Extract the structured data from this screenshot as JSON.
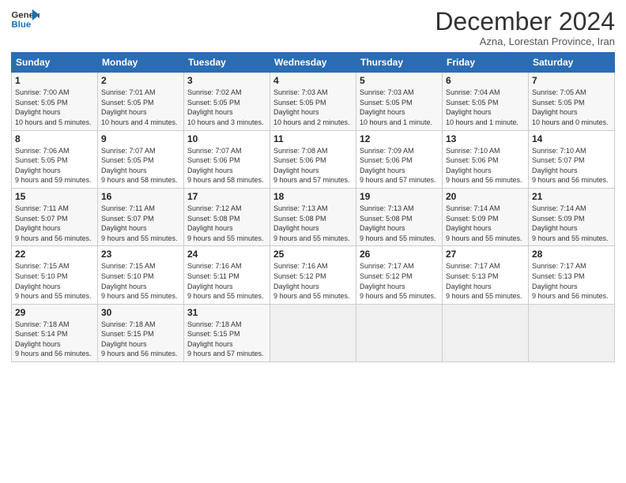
{
  "header": {
    "logo_line1": "General",
    "logo_line2": "Blue",
    "month_title": "December 2024",
    "location": "Azna, Lorestan Province, Iran"
  },
  "weekdays": [
    "Sunday",
    "Monday",
    "Tuesday",
    "Wednesday",
    "Thursday",
    "Friday",
    "Saturday"
  ],
  "weeks": [
    [
      {
        "day": "1",
        "sunrise": "7:00 AM",
        "sunset": "5:05 PM",
        "daylight": "10 hours and 5 minutes."
      },
      {
        "day": "2",
        "sunrise": "7:01 AM",
        "sunset": "5:05 PM",
        "daylight": "10 hours and 4 minutes."
      },
      {
        "day": "3",
        "sunrise": "7:02 AM",
        "sunset": "5:05 PM",
        "daylight": "10 hours and 3 minutes."
      },
      {
        "day": "4",
        "sunrise": "7:03 AM",
        "sunset": "5:05 PM",
        "daylight": "10 hours and 2 minutes."
      },
      {
        "day": "5",
        "sunrise": "7:03 AM",
        "sunset": "5:05 PM",
        "daylight": "10 hours and 1 minute."
      },
      {
        "day": "6",
        "sunrise": "7:04 AM",
        "sunset": "5:05 PM",
        "daylight": "10 hours and 1 minute."
      },
      {
        "day": "7",
        "sunrise": "7:05 AM",
        "sunset": "5:05 PM",
        "daylight": "10 hours and 0 minutes."
      }
    ],
    [
      {
        "day": "8",
        "sunrise": "7:06 AM",
        "sunset": "5:05 PM",
        "daylight": "9 hours and 59 minutes."
      },
      {
        "day": "9",
        "sunrise": "7:07 AM",
        "sunset": "5:05 PM",
        "daylight": "9 hours and 58 minutes."
      },
      {
        "day": "10",
        "sunrise": "7:07 AM",
        "sunset": "5:06 PM",
        "daylight": "9 hours and 58 minutes."
      },
      {
        "day": "11",
        "sunrise": "7:08 AM",
        "sunset": "5:06 PM",
        "daylight": "9 hours and 57 minutes."
      },
      {
        "day": "12",
        "sunrise": "7:09 AM",
        "sunset": "5:06 PM",
        "daylight": "9 hours and 57 minutes."
      },
      {
        "day": "13",
        "sunrise": "7:10 AM",
        "sunset": "5:06 PM",
        "daylight": "9 hours and 56 minutes."
      },
      {
        "day": "14",
        "sunrise": "7:10 AM",
        "sunset": "5:07 PM",
        "daylight": "9 hours and 56 minutes."
      }
    ],
    [
      {
        "day": "15",
        "sunrise": "7:11 AM",
        "sunset": "5:07 PM",
        "daylight": "9 hours and 56 minutes."
      },
      {
        "day": "16",
        "sunrise": "7:11 AM",
        "sunset": "5:07 PM",
        "daylight": "9 hours and 55 minutes."
      },
      {
        "day": "17",
        "sunrise": "7:12 AM",
        "sunset": "5:08 PM",
        "daylight": "9 hours and 55 minutes."
      },
      {
        "day": "18",
        "sunrise": "7:13 AM",
        "sunset": "5:08 PM",
        "daylight": "9 hours and 55 minutes."
      },
      {
        "day": "19",
        "sunrise": "7:13 AM",
        "sunset": "5:08 PM",
        "daylight": "9 hours and 55 minutes."
      },
      {
        "day": "20",
        "sunrise": "7:14 AM",
        "sunset": "5:09 PM",
        "daylight": "9 hours and 55 minutes."
      },
      {
        "day": "21",
        "sunrise": "7:14 AM",
        "sunset": "5:09 PM",
        "daylight": "9 hours and 55 minutes."
      }
    ],
    [
      {
        "day": "22",
        "sunrise": "7:15 AM",
        "sunset": "5:10 PM",
        "daylight": "9 hours and 55 minutes."
      },
      {
        "day": "23",
        "sunrise": "7:15 AM",
        "sunset": "5:10 PM",
        "daylight": "9 hours and 55 minutes."
      },
      {
        "day": "24",
        "sunrise": "7:16 AM",
        "sunset": "5:11 PM",
        "daylight": "9 hours and 55 minutes."
      },
      {
        "day": "25",
        "sunrise": "7:16 AM",
        "sunset": "5:12 PM",
        "daylight": "9 hours and 55 minutes."
      },
      {
        "day": "26",
        "sunrise": "7:17 AM",
        "sunset": "5:12 PM",
        "daylight": "9 hours and 55 minutes."
      },
      {
        "day": "27",
        "sunrise": "7:17 AM",
        "sunset": "5:13 PM",
        "daylight": "9 hours and 55 minutes."
      },
      {
        "day": "28",
        "sunrise": "7:17 AM",
        "sunset": "5:13 PM",
        "daylight": "9 hours and 56 minutes."
      }
    ],
    [
      {
        "day": "29",
        "sunrise": "7:18 AM",
        "sunset": "5:14 PM",
        "daylight": "9 hours and 56 minutes."
      },
      {
        "day": "30",
        "sunrise": "7:18 AM",
        "sunset": "5:15 PM",
        "daylight": "9 hours and 56 minutes."
      },
      {
        "day": "31",
        "sunrise": "7:18 AM",
        "sunset": "5:15 PM",
        "daylight": "9 hours and 57 minutes."
      },
      null,
      null,
      null,
      null
    ]
  ]
}
